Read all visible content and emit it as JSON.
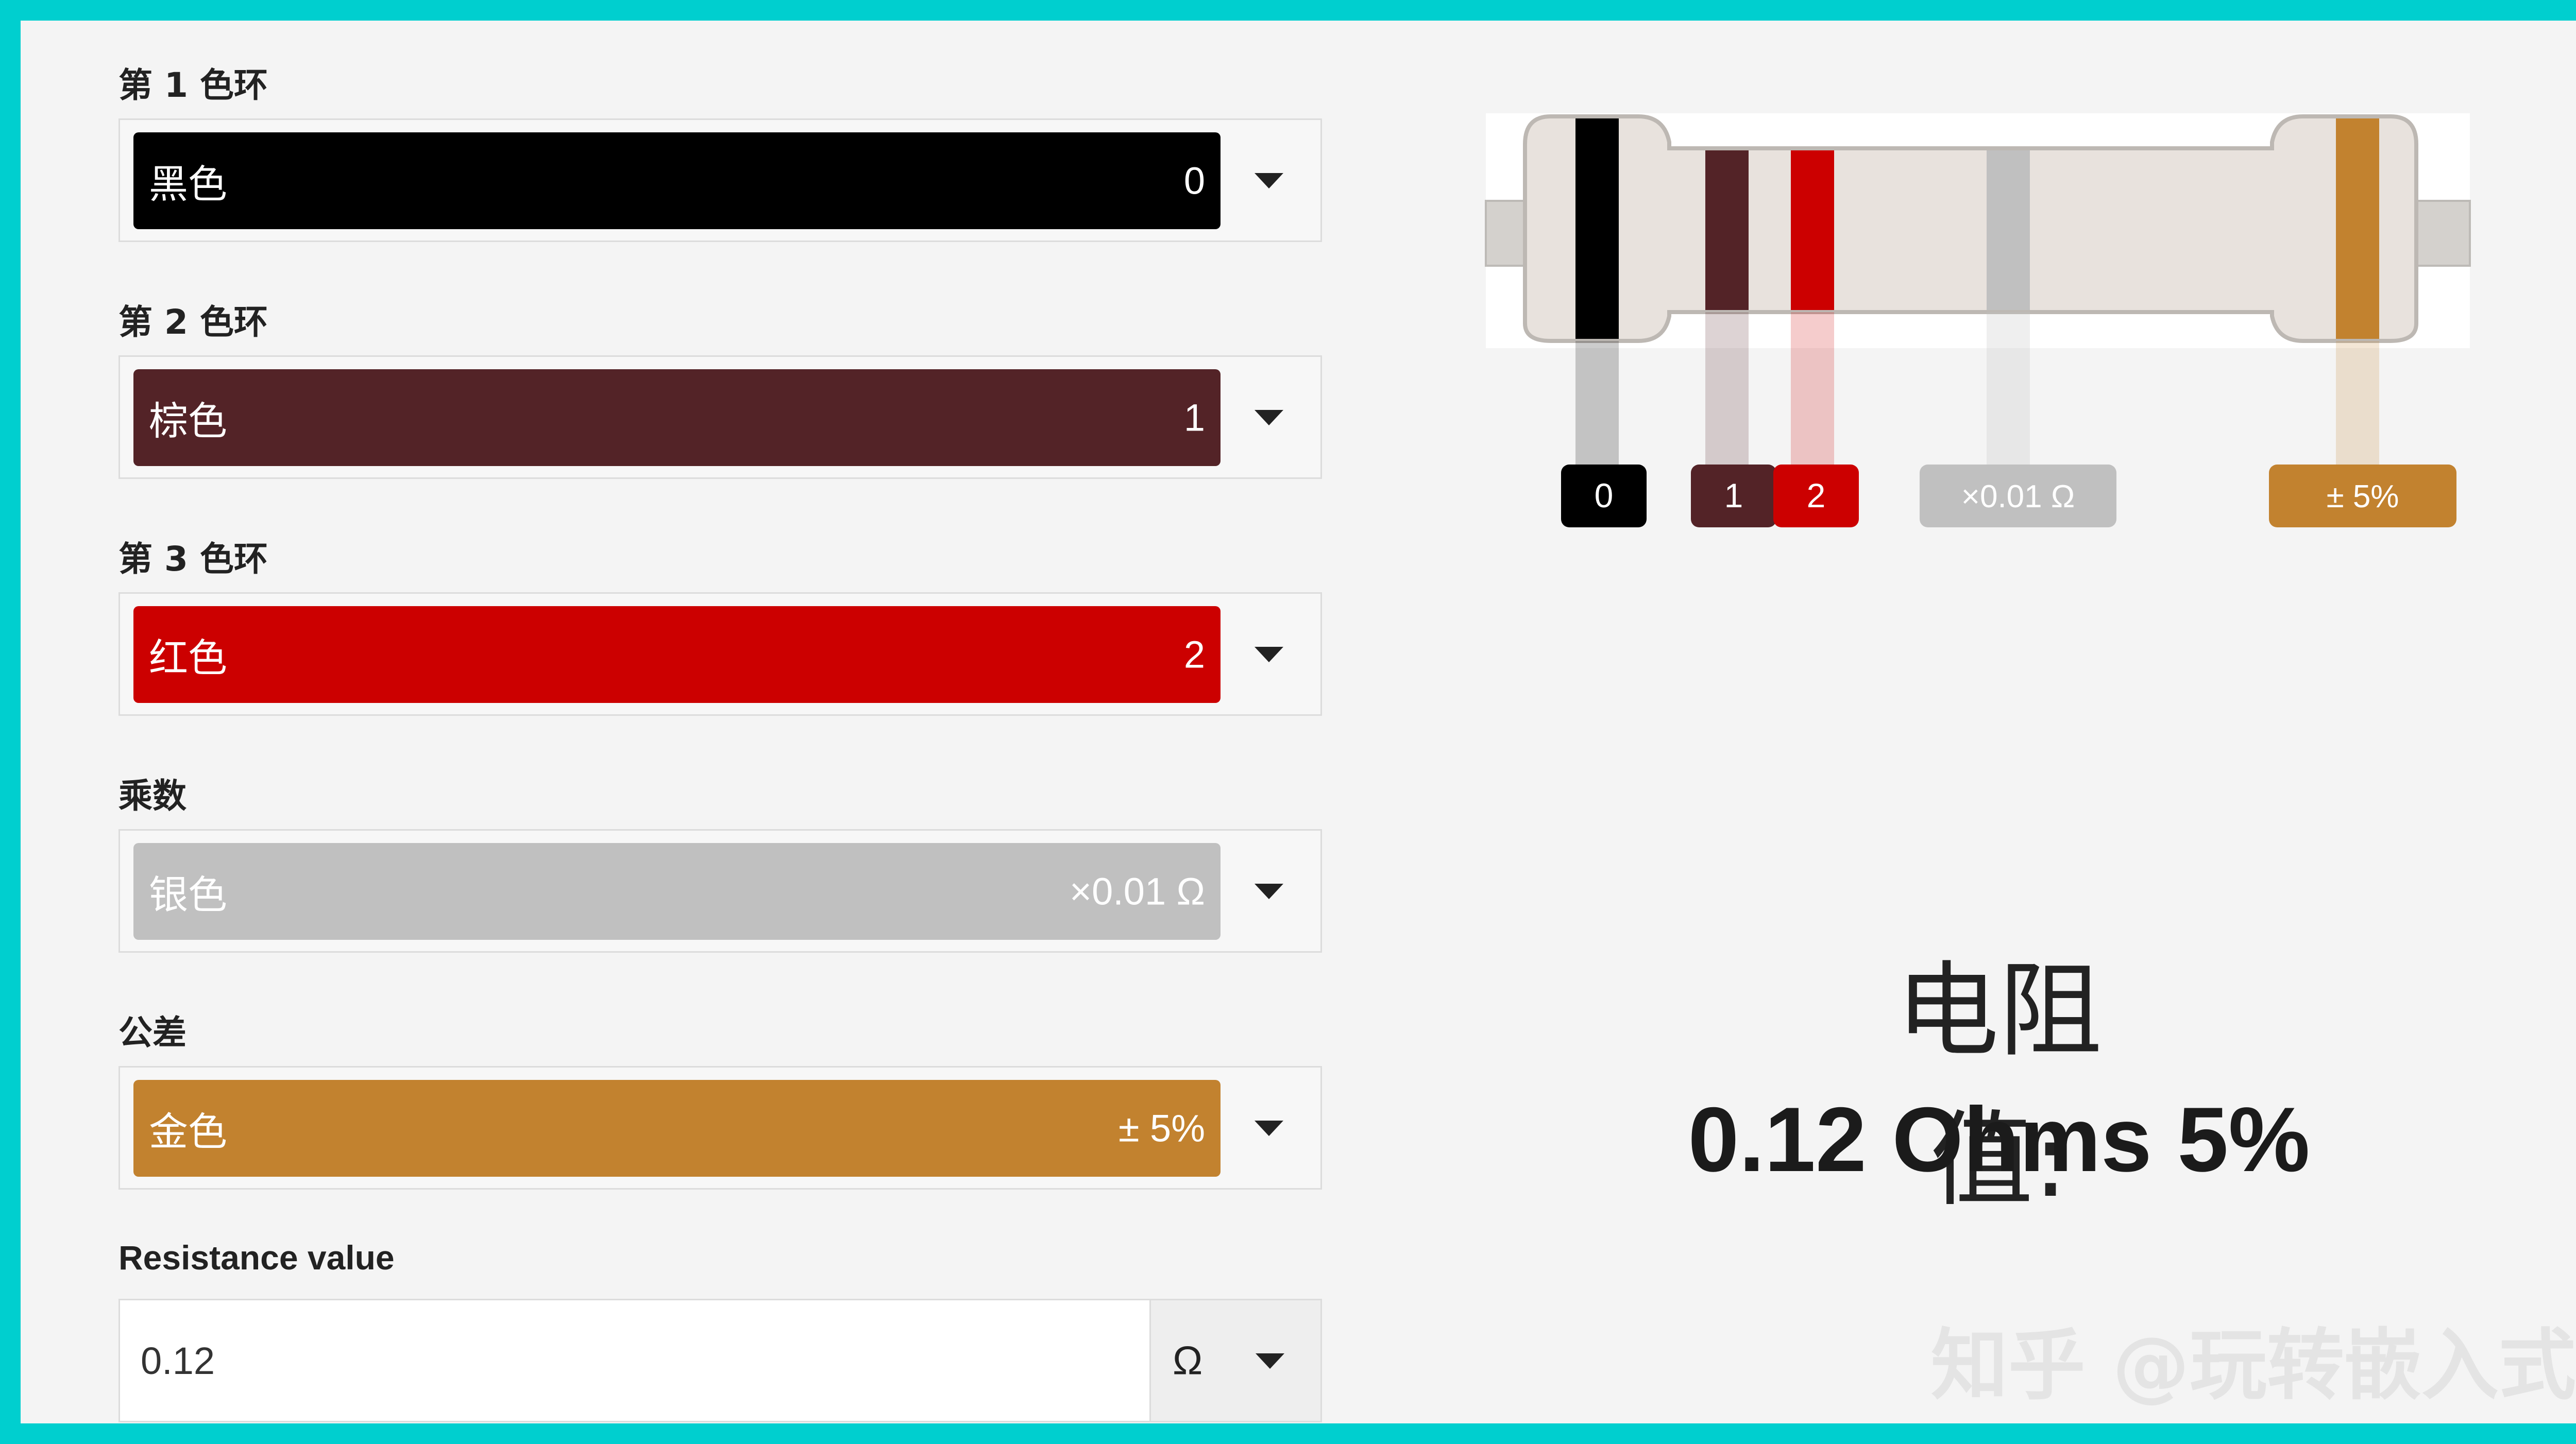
{
  "bands": [
    {
      "label": "第 1 色环",
      "name": "黑色",
      "value": "0",
      "color": "#000000",
      "text_color": "#ffffff"
    },
    {
      "label": "第 2 色环",
      "name": "棕色",
      "value": "1",
      "color": "#532327",
      "text_color": "#ffffff"
    },
    {
      "label": "第 3 色环",
      "name": "红色",
      "value": "2",
      "color": "#cc0000",
      "text_color": "#ffffff"
    },
    {
      "label": "乘数",
      "name": "银色",
      "value": "×0.01 Ω",
      "color": "#c0c0c0",
      "text_color": "#ffffff"
    },
    {
      "label": "公差",
      "name": "金色",
      "value": "± 5%",
      "color": "#c2822f",
      "text_color": "#ffffff"
    }
  ],
  "resistance": {
    "label": "Resistance value",
    "value": "0.12",
    "unit": "Ω"
  },
  "diagram_tags": [
    "0",
    "1",
    "2",
    "×0.01 Ω",
    "± 5%"
  ],
  "result": {
    "title": "电阻值:",
    "value": "0.12 Ohms 5%"
  },
  "watermark": "知乎 @玩转嵌入式"
}
